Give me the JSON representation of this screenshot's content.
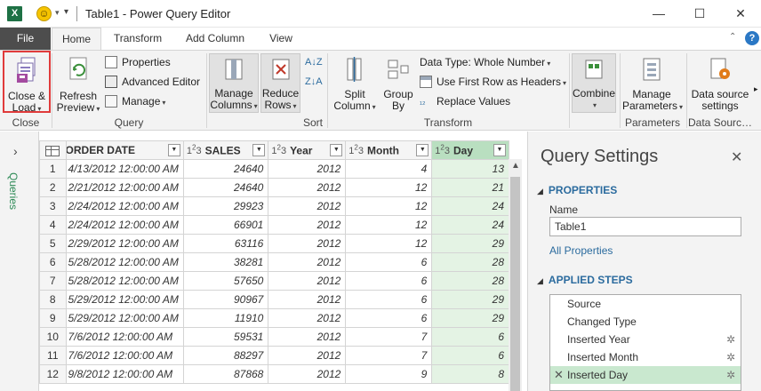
{
  "titlebar": {
    "app_icon": "X",
    "title": "Table1 - Power Query Editor",
    "icons": [
      "excel-icon",
      "smiley-feedback-icon",
      "customize-quick-access-icon",
      "minimize-icon",
      "maximize-icon",
      "close-icon"
    ],
    "minimize": "—",
    "maximize": "☐",
    "close": "✕"
  },
  "tabs": {
    "file": "File",
    "items": [
      "Home",
      "Transform",
      "Add Column",
      "View"
    ],
    "active": "Home"
  },
  "ribbon": {
    "close_group": {
      "label": "Close",
      "close_load_1": "Close &",
      "close_load_2": "Load"
    },
    "query_group": {
      "label": "Query",
      "refresh_1": "Refresh",
      "refresh_2": "Preview",
      "properties": "Properties",
      "advanced_editor": "Advanced Editor",
      "manage": "Manage"
    },
    "manage_cols": {
      "line1": "Manage",
      "line2": "Columns"
    },
    "reduce_rows": {
      "line1": "Reduce",
      "line2": "Rows"
    },
    "sort_group": {
      "label": "Sort",
      "az": "A↓Z",
      "za": "Z↓A"
    },
    "transform_group": {
      "label": "Transform",
      "split_1": "Split",
      "split_2": "Column",
      "group_1": "Group",
      "group_2": "By",
      "data_type": "Data Type: Whole Number",
      "first_row": "Use First Row as Headers",
      "replace": "Replace Values"
    },
    "combine": {
      "label": "Combine"
    },
    "parameters_group": {
      "label": "Parameters",
      "line1": "Manage",
      "line2": "Parameters"
    },
    "datasource_group": {
      "label": "Data Sourc…",
      "line1": "Data source",
      "line2": "settings"
    },
    "more": "▸"
  },
  "query_pane": {
    "label": "Queries",
    "arrow": "›"
  },
  "grid": {
    "columns": [
      {
        "name": "ORDER DATE",
        "type": ""
      },
      {
        "name": "SALES",
        "type": "123"
      },
      {
        "name": "Year",
        "type": "123"
      },
      {
        "name": "Month",
        "type": "123"
      },
      {
        "name": "Day",
        "type": "123"
      }
    ],
    "rows": [
      [
        "1",
        "4/13/2012 12:00:00 AM",
        "24640",
        "2012",
        "4",
        "13"
      ],
      [
        "2",
        "2/21/2012 12:00:00 AM",
        "24640",
        "2012",
        "12",
        "21"
      ],
      [
        "3",
        "2/24/2012 12:00:00 AM",
        "29923",
        "2012",
        "12",
        "24"
      ],
      [
        "4",
        "2/24/2012 12:00:00 AM",
        "66901",
        "2012",
        "12",
        "24"
      ],
      [
        "5",
        "2/29/2012 12:00:00 AM",
        "63116",
        "2012",
        "12",
        "29"
      ],
      [
        "6",
        "5/28/2012 12:00:00 AM",
        "38281",
        "2012",
        "6",
        "28"
      ],
      [
        "7",
        "5/28/2012 12:00:00 AM",
        "57650",
        "2012",
        "6",
        "28"
      ],
      [
        "8",
        "5/29/2012 12:00:00 AM",
        "90967",
        "2012",
        "6",
        "29"
      ],
      [
        "9",
        "5/29/2012 12:00:00 AM",
        "11910",
        "2012",
        "6",
        "29"
      ],
      [
        "10",
        "7/6/2012 12:00:00 AM",
        "59531",
        "2012",
        "7",
        "6"
      ],
      [
        "11",
        "7/6/2012 12:00:00 AM",
        "88297",
        "2012",
        "7",
        "6"
      ],
      [
        "12",
        "9/8/2012 12:00:00 AM",
        "87868",
        "2012",
        "9",
        "8"
      ]
    ]
  },
  "settings": {
    "title": "Query Settings",
    "close": "✕",
    "properties_header": "PROPERTIES",
    "name_label": "Name",
    "name_value": "Table1",
    "all_properties": "All Properties",
    "steps_header": "APPLIED STEPS",
    "steps": [
      {
        "label": "Source",
        "gear": false
      },
      {
        "label": "Changed Type",
        "gear": false
      },
      {
        "label": "Inserted Year",
        "gear": true
      },
      {
        "label": "Inserted Month",
        "gear": true
      },
      {
        "label": "Inserted Day",
        "gear": true,
        "selected": true
      }
    ]
  },
  "colors": {
    "file_tab": "#4d4d4d",
    "selected_column": "#b9dfc0",
    "selected_step": "#c9e8cf",
    "section_header": "#2b6b9e",
    "highlight_box": "#e03b3b",
    "queries_label": "#2e8b57"
  }
}
